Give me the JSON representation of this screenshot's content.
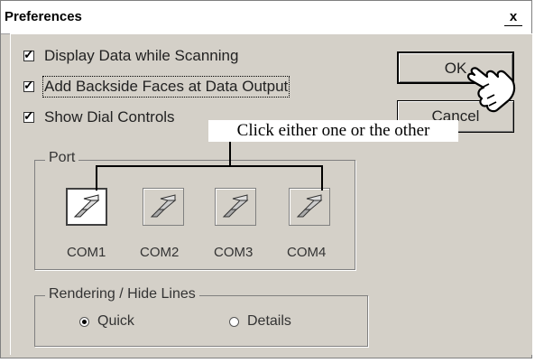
{
  "window": {
    "title": "Preferences",
    "close_glyph": "x"
  },
  "options": [
    {
      "label": "Display Data while Scanning",
      "checked": true
    },
    {
      "label": "Add Backside Faces at Data Output",
      "checked": true
    },
    {
      "label": "Show Dial Controls",
      "checked": true
    }
  ],
  "buttons": {
    "ok": "OK",
    "cancel": "Cancel"
  },
  "port_group": {
    "label": "Port",
    "ports": [
      {
        "label": "COM1",
        "selected": true
      },
      {
        "label": "COM2",
        "selected": false
      },
      {
        "label": "COM3",
        "selected": false
      },
      {
        "label": "COM4",
        "selected": false
      }
    ]
  },
  "rendering_group": {
    "label": "Rendering / Hide Lines",
    "options": [
      {
        "label": "Quick",
        "selected": true
      },
      {
        "label": "Details",
        "selected": false
      }
    ]
  },
  "annotation": {
    "text": "Click either one or the other"
  },
  "icons": {
    "port": "serial-port-icon",
    "cursor": "pointing-hand-cursor-icon"
  }
}
